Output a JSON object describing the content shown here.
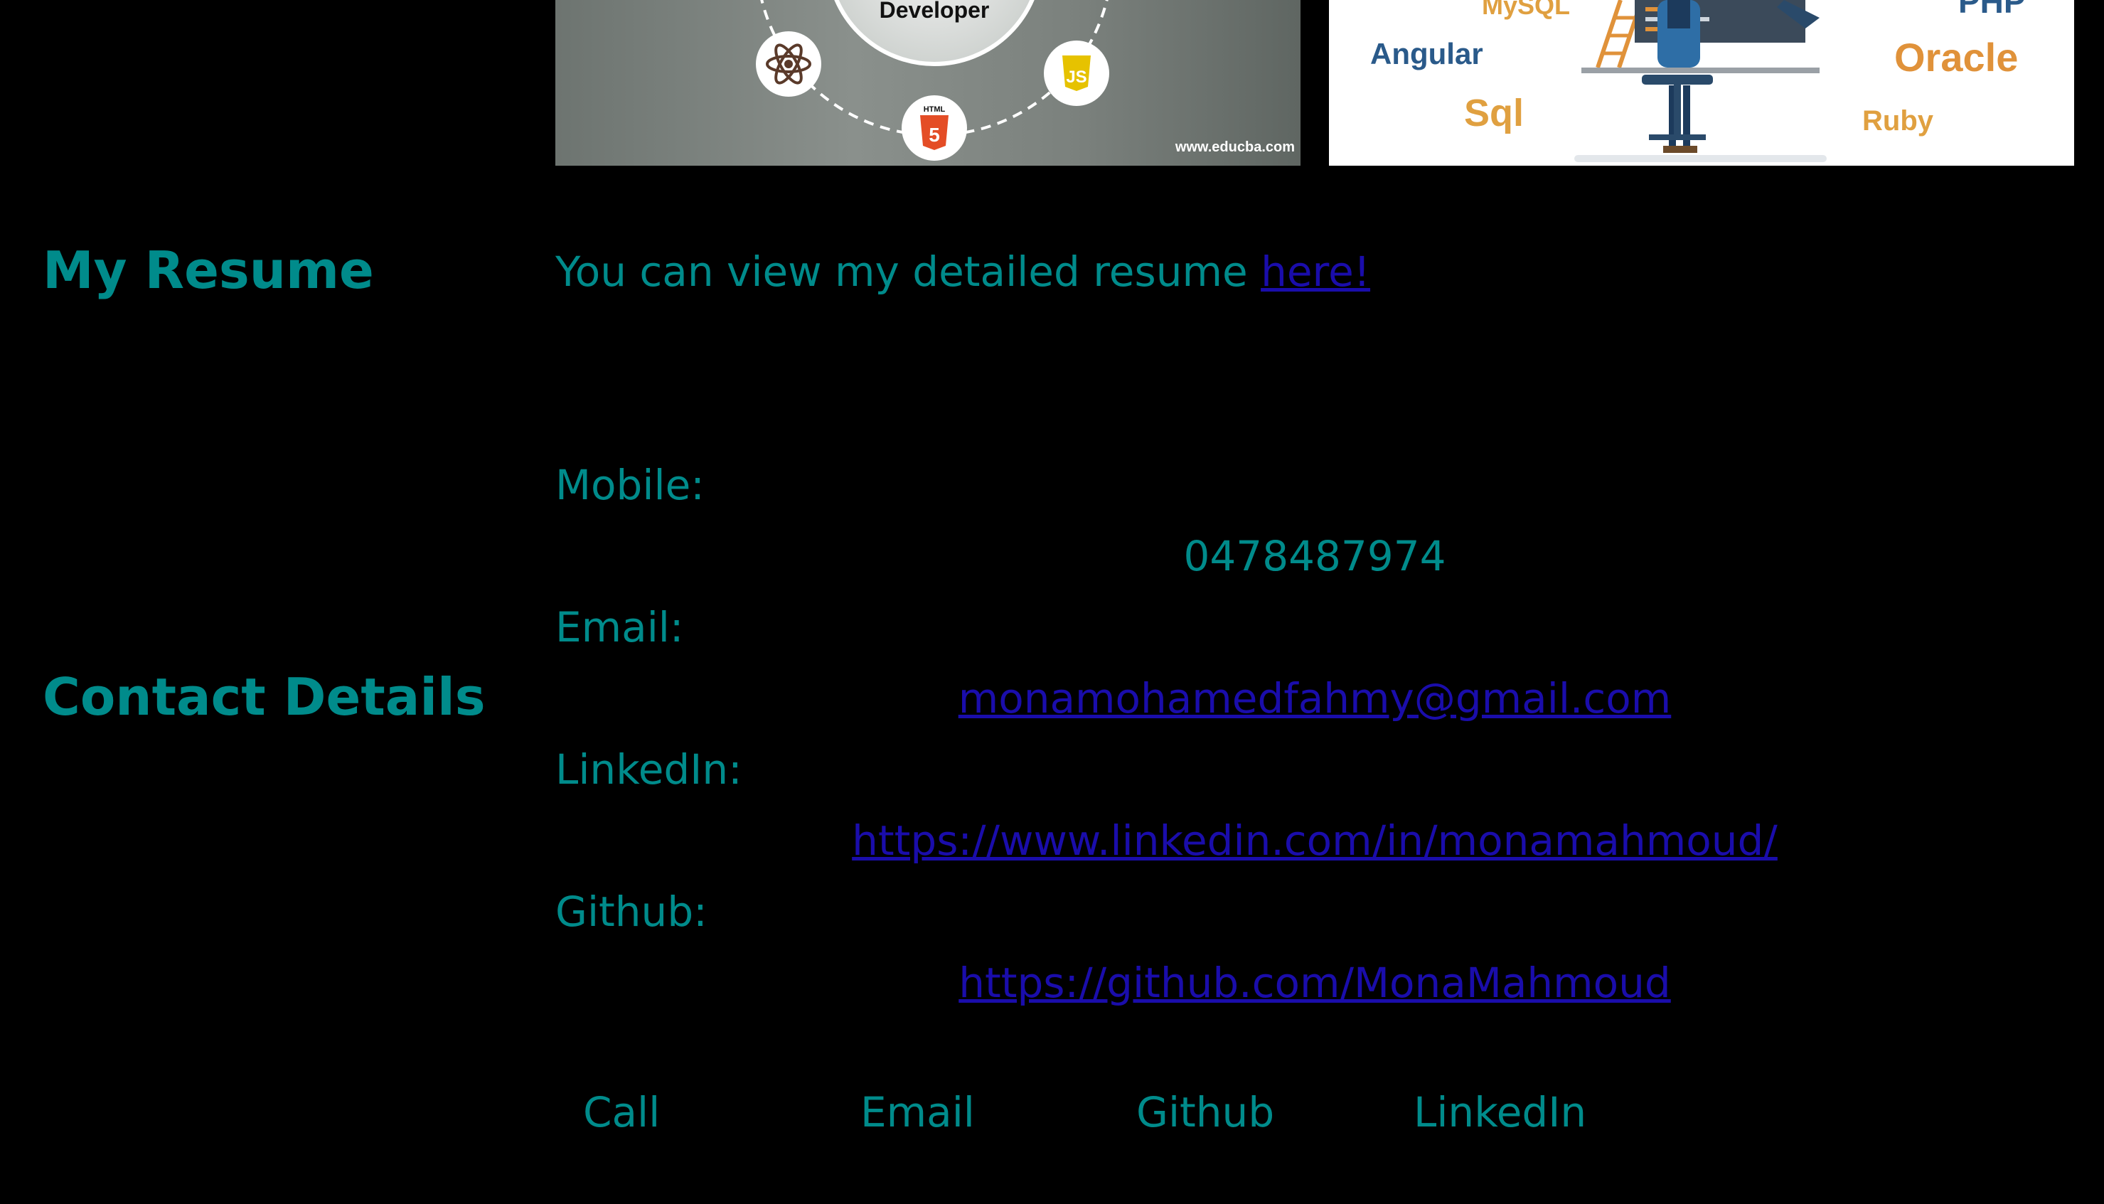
{
  "images": {
    "left": {
      "heading": "Developer",
      "credit": "www.educba.com",
      "html_badge": "HTML",
      "html_number": "5",
      "js_badge": "JS"
    },
    "right": {
      "words": [
        "MySQL",
        "PHP",
        "Angular",
        "Oracle",
        "Sql",
        "Ruby"
      ]
    }
  },
  "resume": {
    "title": "My Resume",
    "text": "You can view my detailed resume ",
    "link_label": "here!"
  },
  "contact": {
    "title": "Contact Details",
    "mobile_label": "Mobile:",
    "mobile_value": "0478487974",
    "email_label": "Email:",
    "email_value": "monamohamedfahmy@gmail.com",
    "linkedin_label": "LinkedIn:",
    "linkedin_value": "https://www.linkedin.com/in/monamahmoud/",
    "github_label": "Github:",
    "github_value": "https://github.com/MonaMahmoud"
  },
  "footer": {
    "call": "Call",
    "email": "Email",
    "github": "Github",
    "linkedin": "LinkedIn"
  },
  "colors": {
    "background": "#000000",
    "teal": "#008b8b",
    "link": "#1a0dab"
  }
}
